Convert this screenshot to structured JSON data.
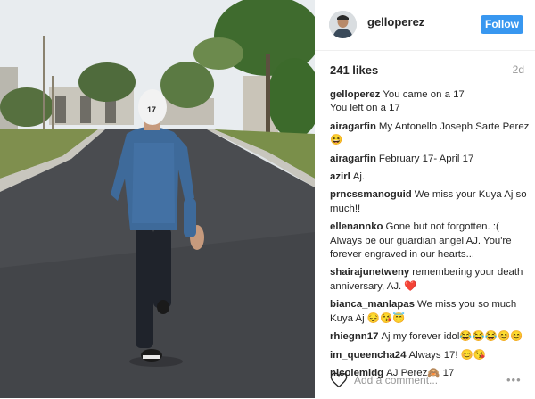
{
  "header": {
    "username": "gelloperez",
    "follow_label": "Follow"
  },
  "meta": {
    "likes": "241 likes",
    "time": "2d"
  },
  "comments": [
    {
      "user": "gelloperez",
      "text": "You came on a 17\nYou left on a 17"
    },
    {
      "user": "airagarfin",
      "text": "My Antonello Joseph Sarte Perez 😆"
    },
    {
      "user": "airagarfin",
      "text": "February 17- April 17"
    },
    {
      "user": "azirl",
      "text": "Aj."
    },
    {
      "user": "prncssmanoguid",
      "text": "We miss your Kuya Aj so much!!"
    },
    {
      "user": "ellenannko",
      "text": "Gone but not forgotten. :( Always be our guardian angel AJ. You're forever engraved in our hearts..."
    },
    {
      "user": "shairajunetweny",
      "text": "remembering your death anniversary, AJ. ❤️"
    },
    {
      "user": "bianca_manlapas",
      "text": "We miss you so much Kuya Aj 😔😘😇"
    },
    {
      "user": "rhiegnn17",
      "text": "Aj my forever idol😂😂😂😊😊"
    },
    {
      "user": "im_queencha24",
      "text": "Always 17! 😊😘"
    },
    {
      "user": "nicolemldg",
      "text": "AJ Perez🙈 17"
    }
  ],
  "add_comment": {
    "placeholder": "Add a comment...",
    "more": "•••"
  },
  "photo": {
    "cap_number": "17"
  },
  "colors": {
    "follow_bg": "#3897f0",
    "text": "#262626",
    "muted": "#999999"
  },
  "icons": [
    "heart-icon",
    "more-options-icon"
  ]
}
